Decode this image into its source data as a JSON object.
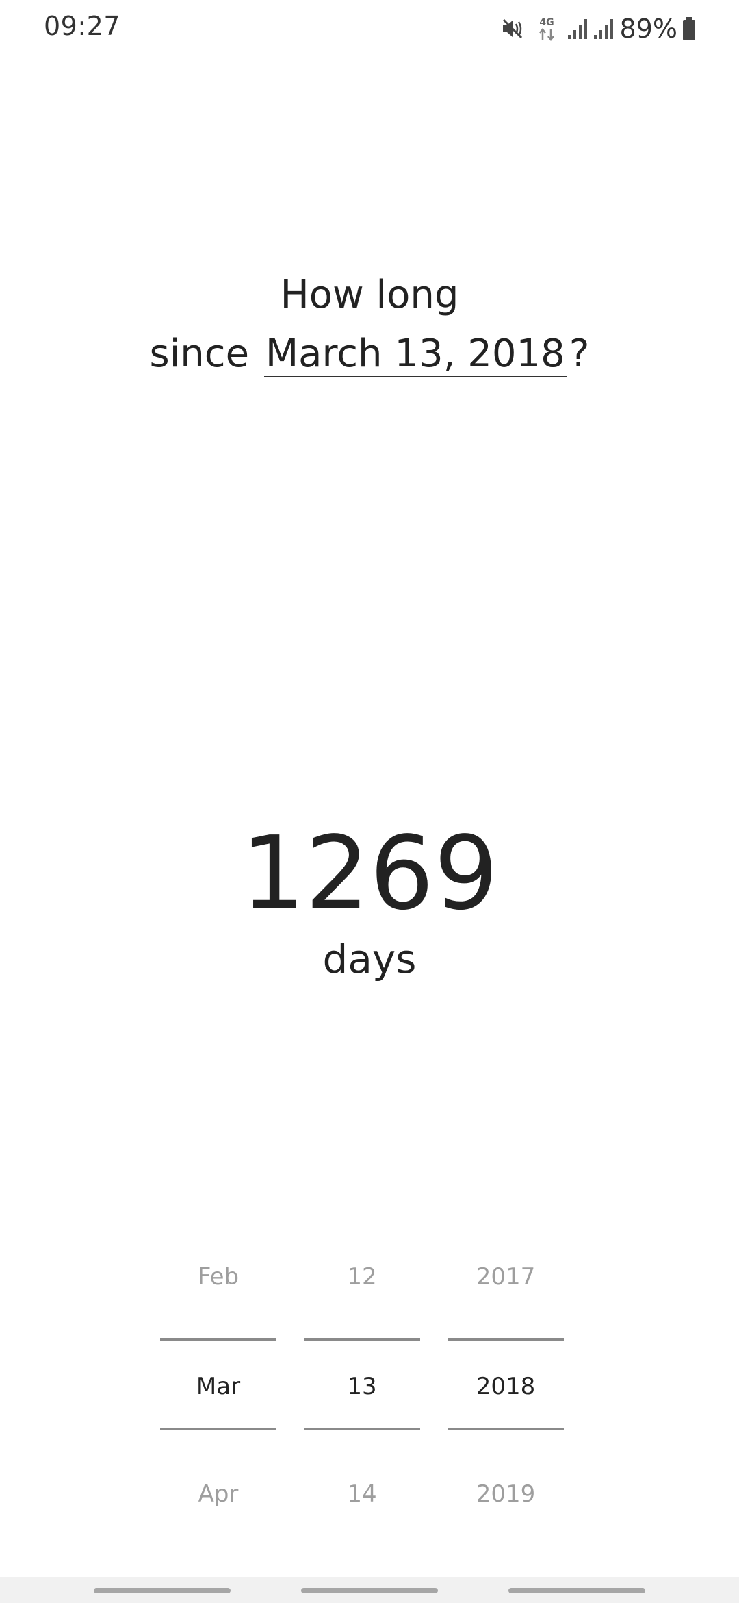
{
  "status_bar": {
    "time": "09:27",
    "icons": [
      "mute-icon",
      "4g-data-icon",
      "signal-icon",
      "signal-icon",
      "battery-icon"
    ],
    "network_label": "4G",
    "battery_percent": "89%"
  },
  "question": {
    "line1": "How long",
    "prefix": "since",
    "date": "March 13, 2018",
    "suffix": "?"
  },
  "result": {
    "value": "1269",
    "unit": "days"
  },
  "date_picker": {
    "month": {
      "prev": "Feb",
      "current": "Mar",
      "next": "Apr"
    },
    "day": {
      "prev": "12",
      "current": "13",
      "next": "14"
    },
    "year": {
      "prev": "2017",
      "current": "2018",
      "next": "2019"
    }
  },
  "colors": {
    "text": "#222222",
    "muted": "#9e9e9e",
    "picker_line": "#8a8a8a",
    "nav_bar": "#f1f1f1"
  }
}
